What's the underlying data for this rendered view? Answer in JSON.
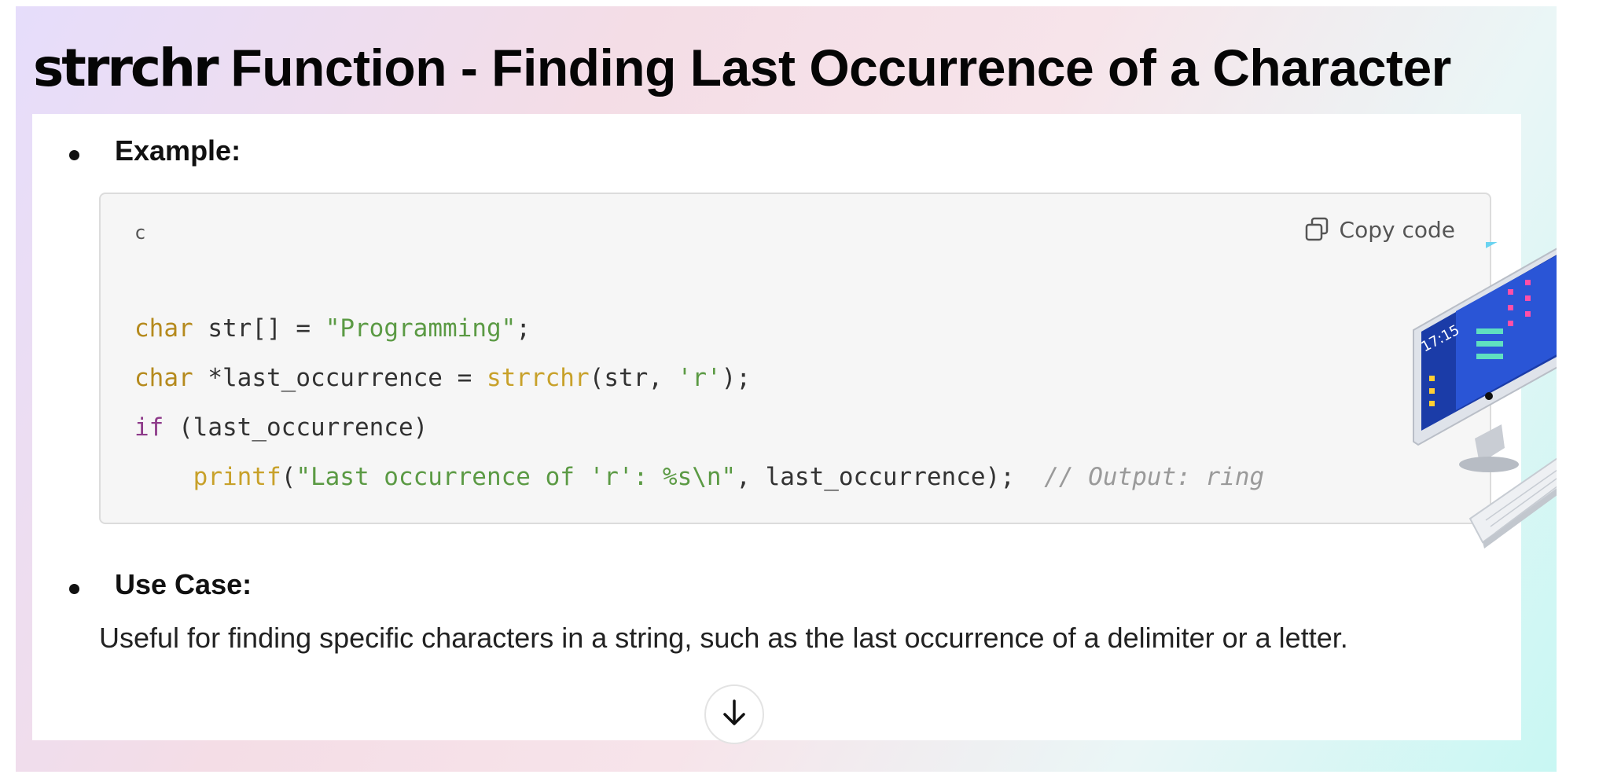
{
  "slide": {
    "title_code": "strrchr",
    "title_rest": " Function - Finding Last Occurrence of a Character"
  },
  "example": {
    "label": "Example:",
    "code_language": "c",
    "copy_label": "Copy code",
    "code_lines": [
      "char str[] = \"Programming\";",
      "char *last_occurrence = strrchr(str, 'r');",
      "if (last_occurrence)",
      "    printf(\"Last occurrence of 'r': %s\\n\", last_occurrence);  // Output: ring"
    ]
  },
  "use_case": {
    "label": "Use Case:",
    "text": "Useful for finding specific characters in a string, such as the last occurrence of a delimiter or a letter."
  },
  "illustration": {
    "clock_time": "17:15"
  },
  "icons": {
    "copy": "copy-icon",
    "scroll_down": "arrow-down-icon",
    "next_slide": "chevron-right-icon",
    "computer": "computer-illustration"
  },
  "colors": {
    "keyword": "#b58a1d",
    "control": "#8e3b8a",
    "string": "#5b9a44",
    "function": "#c8a12a",
    "comment": "#9a9a9a",
    "next_button": "#2d5cc7"
  }
}
